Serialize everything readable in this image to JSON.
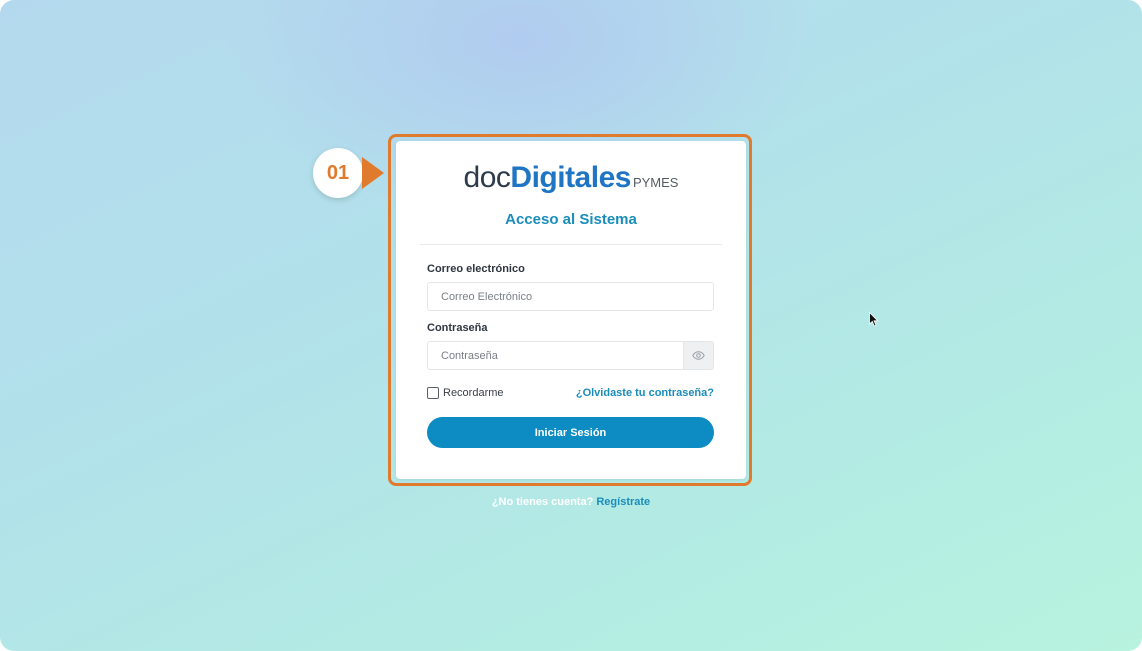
{
  "step": {
    "number": "01"
  },
  "logo": {
    "doc": "doc",
    "digitales": "Digitales",
    "pymes": "PYMES"
  },
  "login": {
    "title": "Acceso al Sistema",
    "email_label": "Correo electrónico",
    "email_placeholder": "Correo Electrónico",
    "email_value": "",
    "password_label": "Contraseña",
    "password_placeholder": "Contraseña",
    "password_value": "",
    "remember_label": "Recordarme",
    "remember_checked": false,
    "forgot_link": "¿Olvidaste tu contraseña?",
    "submit_label": "Iniciar Sesión"
  },
  "footer": {
    "question": "¿No tienes cuenta?",
    "register_link": "Regístrate"
  },
  "icons": {
    "password_toggle": "eye-icon",
    "pointer": "mouse-cursor-icon"
  },
  "colors": {
    "accent": "#1a8dbb",
    "button": "#0d8cc4",
    "highlight": "#e07a2c",
    "logo_blue": "#1f74c4"
  }
}
